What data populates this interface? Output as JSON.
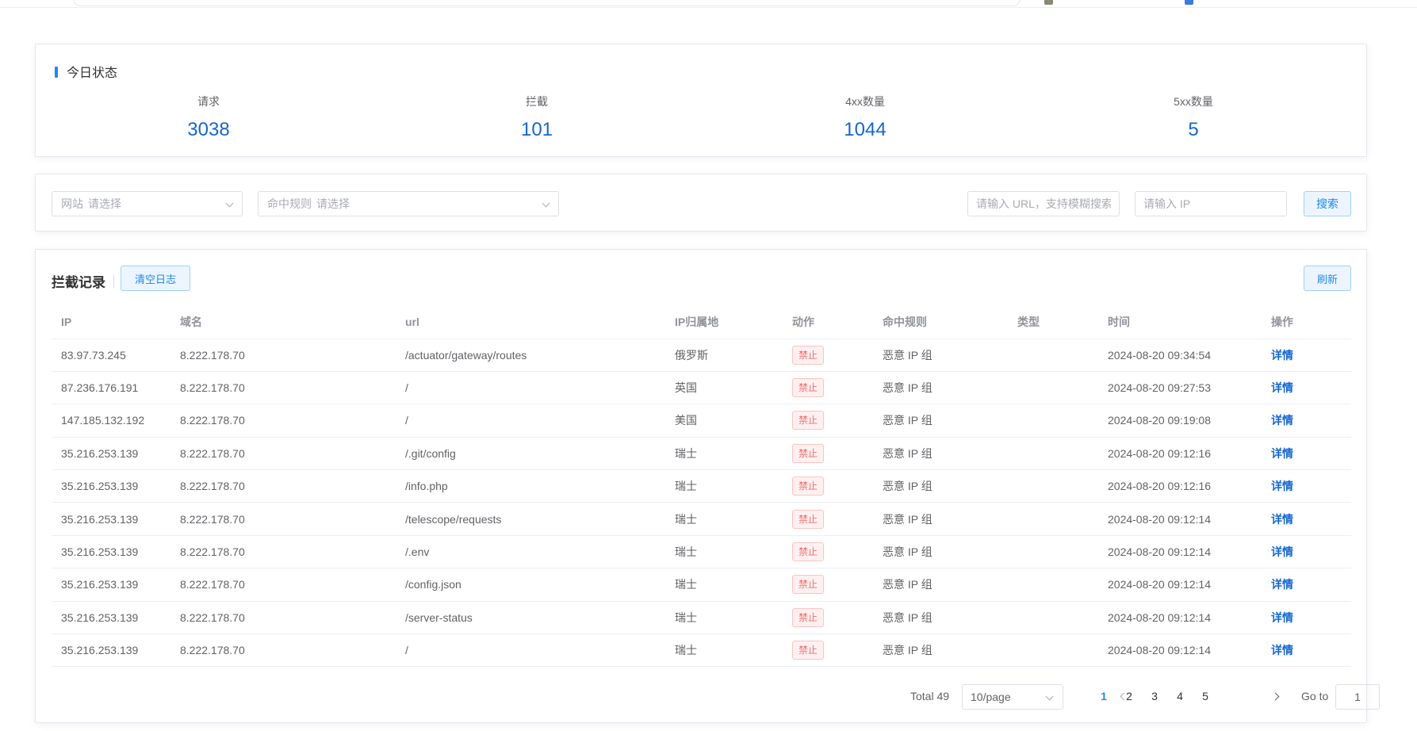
{
  "status": {
    "title": "今日状态",
    "items": [
      {
        "label": "请求",
        "value": "3038"
      },
      {
        "label": "拦截",
        "value": "101"
      },
      {
        "label": "4xx数量",
        "value": "1044"
      },
      {
        "label": "5xx数量",
        "value": "5"
      }
    ]
  },
  "filter": {
    "site_prefix": "网站",
    "site_placeholder": "请选择",
    "rule_prefix": "命中规则",
    "rule_placeholder": "请选择",
    "url_placeholder": "请输入 URL，支持模糊搜索",
    "ip_placeholder": "请输入 IP",
    "search_label": "搜索"
  },
  "records": {
    "title": "拦截记录",
    "clear_label": "清空日志",
    "refresh_label": "刷新",
    "columns": [
      "IP",
      "域名",
      "url",
      "IP归属地",
      "动作",
      "命中规则",
      "类型",
      "时间",
      "操作"
    ],
    "rows": [
      {
        "ip": "83.97.73.245",
        "domain": "8.222.178.70",
        "url": "/actuator/gateway/routes",
        "location": "俄罗斯",
        "action": "禁止",
        "rule": "恶意 IP 组",
        "type": "",
        "time": "2024-08-20 09:34:54",
        "op": "详情"
      },
      {
        "ip": "87.236.176.191",
        "domain": "8.222.178.70",
        "url": "/",
        "location": "英国",
        "action": "禁止",
        "rule": "恶意 IP 组",
        "type": "",
        "time": "2024-08-20 09:27:53",
        "op": "详情"
      },
      {
        "ip": "147.185.132.192",
        "domain": "8.222.178.70",
        "url": "/",
        "location": "美国",
        "action": "禁止",
        "rule": "恶意 IP 组",
        "type": "",
        "time": "2024-08-20 09:19:08",
        "op": "详情"
      },
      {
        "ip": "35.216.253.139",
        "domain": "8.222.178.70",
        "url": "/.git/config",
        "location": "瑞士",
        "action": "禁止",
        "rule": "恶意 IP 组",
        "type": "",
        "time": "2024-08-20 09:12:16",
        "op": "详情"
      },
      {
        "ip": "35.216.253.139",
        "domain": "8.222.178.70",
        "url": "/info.php",
        "location": "瑞士",
        "action": "禁止",
        "rule": "恶意 IP 组",
        "type": "",
        "time": "2024-08-20 09:12:16",
        "op": "详情"
      },
      {
        "ip": "35.216.253.139",
        "domain": "8.222.178.70",
        "url": "/telescope/requests",
        "location": "瑞士",
        "action": "禁止",
        "rule": "恶意 IP 组",
        "type": "",
        "time": "2024-08-20 09:12:14",
        "op": "详情"
      },
      {
        "ip": "35.216.253.139",
        "domain": "8.222.178.70",
        "url": "/.env",
        "location": "瑞士",
        "action": "禁止",
        "rule": "恶意 IP 组",
        "type": "",
        "time": "2024-08-20 09:12:14",
        "op": "详情"
      },
      {
        "ip": "35.216.253.139",
        "domain": "8.222.178.70",
        "url": "/config.json",
        "location": "瑞士",
        "action": "禁止",
        "rule": "恶意 IP 组",
        "type": "",
        "time": "2024-08-20 09:12:14",
        "op": "详情"
      },
      {
        "ip": "35.216.253.139",
        "domain": "8.222.178.70",
        "url": "/server-status",
        "location": "瑞士",
        "action": "禁止",
        "rule": "恶意 IP 组",
        "type": "",
        "time": "2024-08-20 09:12:14",
        "op": "详情"
      },
      {
        "ip": "35.216.253.139",
        "domain": "8.222.178.70",
        "url": "/",
        "location": "瑞士",
        "action": "禁止",
        "rule": "恶意 IP 组",
        "type": "",
        "time": "2024-08-20 09:12:14",
        "op": "详情"
      }
    ]
  },
  "pagination": {
    "total_label": "Total 49",
    "page_size": "10/page",
    "pages": [
      "1",
      "2",
      "3",
      "4",
      "5"
    ],
    "current": "1",
    "goto_label": "Go to",
    "goto_value": "1"
  },
  "colors": {
    "accent": "#1e88f5",
    "stat_number": "#1366d6",
    "danger": "#f56c6c"
  }
}
